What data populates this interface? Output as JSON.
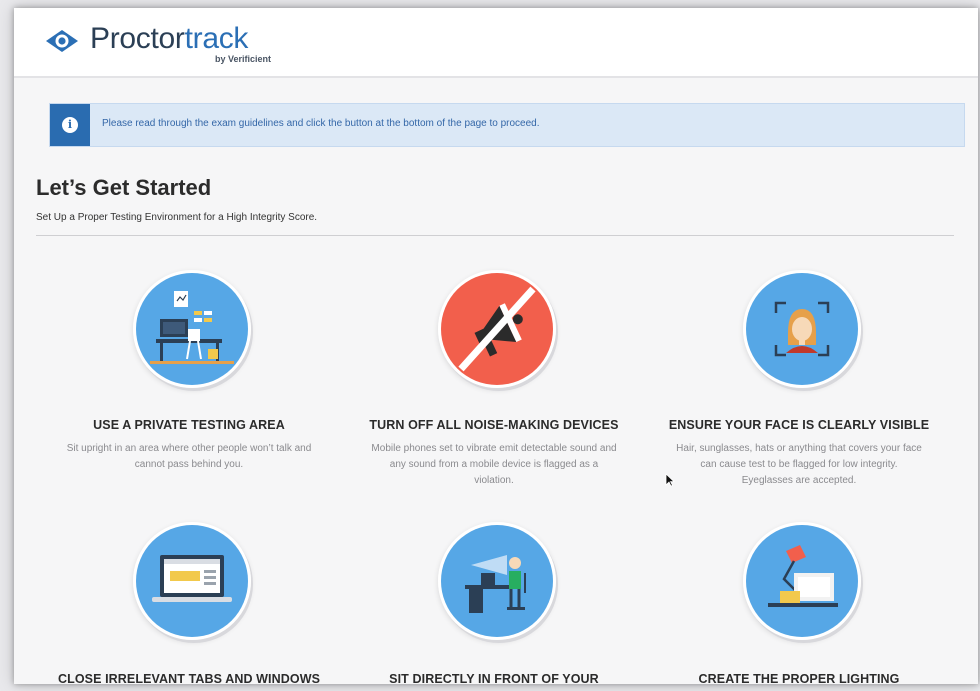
{
  "header": {
    "logo_main": "Proctor",
    "logo_accent": "track",
    "logo_sub": "by Verificient"
  },
  "banner": {
    "icon": "info-icon",
    "text": "Please read through the exam guidelines and click the button at the bottom of the page to proceed."
  },
  "page": {
    "title": "Let’s Get Started",
    "subtitle": "Set Up a Proper Testing Environment for a High Integrity Score."
  },
  "cards": [
    {
      "icon": "private-desk-illustration",
      "title": "USE A PRIVATE TESTING AREA",
      "desc": "Sit upright in an area where other people won’t talk and cannot pass behind you."
    },
    {
      "icon": "no-megaphone-illustration",
      "title": "TURN OFF ALL NOISE-MAKING DEVICES",
      "desc": "Mobile phones set to vibrate emit detectable sound and any sound from a mobile device is flagged as a violation."
    },
    {
      "icon": "face-frame-illustration",
      "title": "ENSURE YOUR FACE IS CLEARLY VISIBLE",
      "desc": "Hair, sunglasses, hats or anything that covers your face can cause test to be flagged for low integrity. Eyeglasses are accepted."
    },
    {
      "icon": "laptop-screen-illustration",
      "title": "CLOSE IRRELEVANT TABS AND WINDOWS",
      "desc": ""
    },
    {
      "icon": "person-at-desk-illustration",
      "title": "SIT DIRECTLY IN FRONT OF YOUR",
      "desc": ""
    },
    {
      "icon": "desk-lamp-illustration",
      "title": "CREATE THE PROPER LIGHTING",
      "desc": ""
    }
  ],
  "colors": {
    "brand_dark": "#2b3f55",
    "brand_blue": "#2b6fb5",
    "banner_bg": "#dbe8f6",
    "circle_blue": "#56a7e6",
    "circle_red": "#f25f4c"
  }
}
